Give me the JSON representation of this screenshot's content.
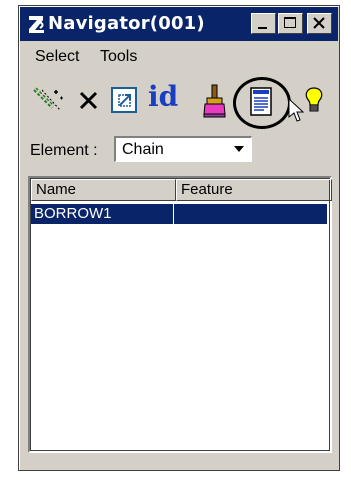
{
  "window": {
    "title": "Navigator(001)"
  },
  "menu": {
    "items": [
      "Select",
      "Tools"
    ]
  },
  "toolbar": {
    "icons": [
      "select-elements-icon",
      "delete-icon",
      "zoom-window-icon",
      "id-icon",
      "paint-brush-icon",
      "report-icon",
      "cursor-pointer-icon",
      "lightbulb-icon"
    ],
    "id_glyph": "id"
  },
  "element": {
    "label": "Element :",
    "value": "Chain"
  },
  "list": {
    "columns": [
      "Name",
      "Feature"
    ],
    "rows": [
      {
        "name": "BORROW1",
        "feature": ""
      }
    ]
  },
  "colors": {
    "titlebar": "#0a246a",
    "selection": "#0a246a",
    "face": "#d4d0c8",
    "id_icon": "#1a3ec2"
  }
}
